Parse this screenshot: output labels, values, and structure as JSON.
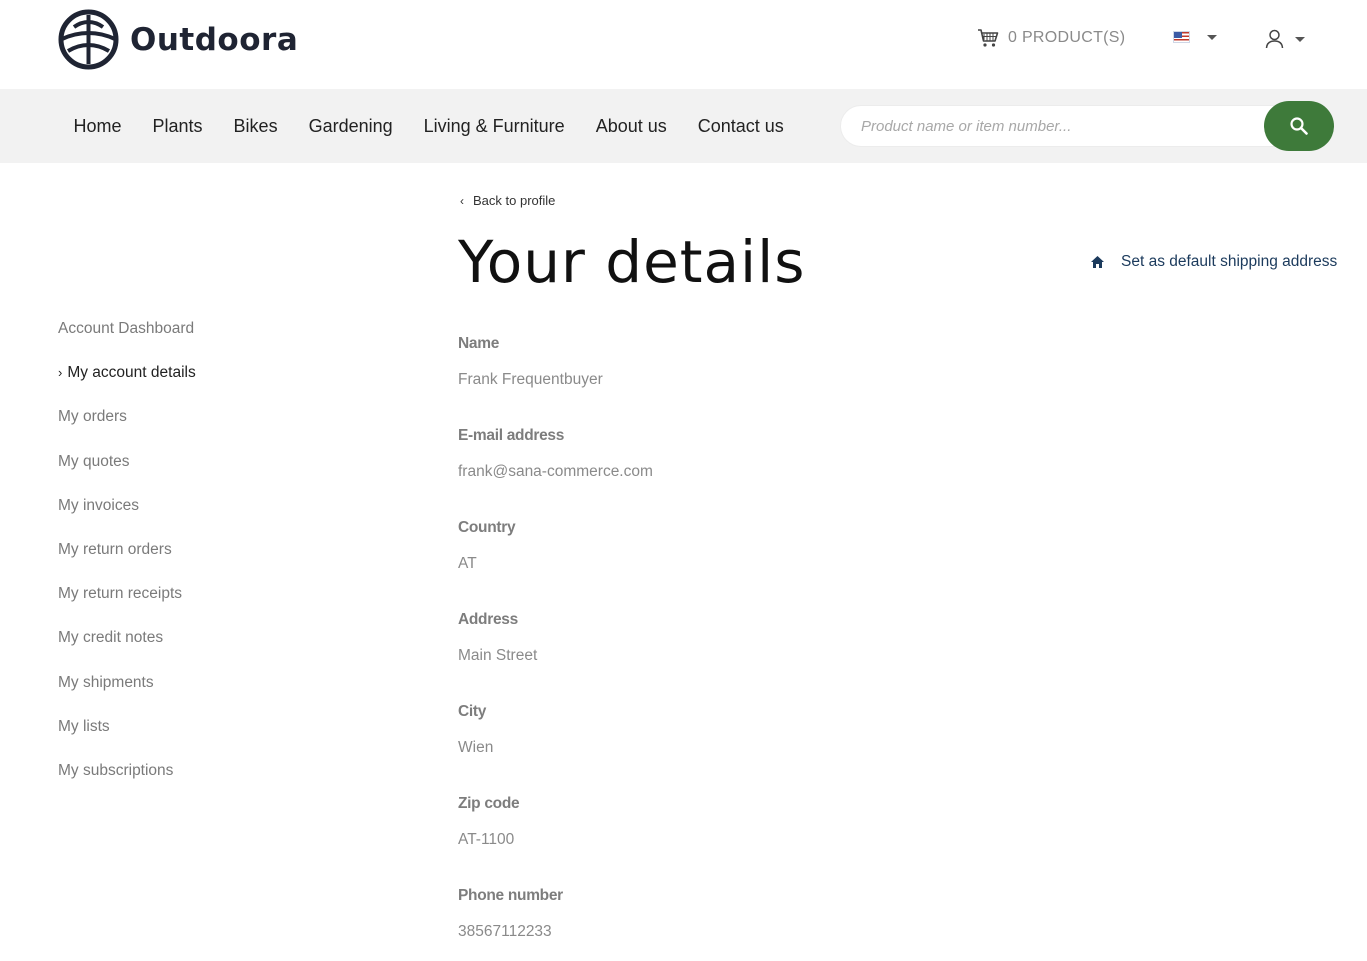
{
  "brand": {
    "name": "Outdoora"
  },
  "header": {
    "cart_label": "0 PRODUCT(S)"
  },
  "nav": {
    "items": [
      "Home",
      "Plants",
      "Bikes",
      "Gardening",
      "Living & Furniture",
      "About us",
      "Contact us"
    ]
  },
  "search": {
    "placeholder": "Product name or item number..."
  },
  "sidebar": {
    "items": [
      "Account Dashboard",
      "My account details",
      "My orders",
      "My quotes",
      "My invoices",
      "My return orders",
      "My return receipts",
      "My credit notes",
      "My shipments",
      "My lists",
      "My subscriptions"
    ]
  },
  "main": {
    "back_label": "Back to profile",
    "title": "Your details",
    "default_shipping_label": "Set as default shipping address",
    "fields": [
      {
        "label": "Name",
        "value": "Frank Frequentbuyer"
      },
      {
        "label": "E-mail address",
        "value": "frank@sana-commerce.com"
      },
      {
        "label": "Country",
        "value": "AT"
      },
      {
        "label": "Address",
        "value": "Main Street"
      },
      {
        "label": "City",
        "value": "Wien"
      },
      {
        "label": "Zip code",
        "value": "AT-1100"
      },
      {
        "label": "Phone number",
        "value": "38567112233"
      }
    ]
  },
  "colors": {
    "accent_green": "#3e7a3a",
    "navbar_bg": "#f2f2f2",
    "link_blue": "#1b3a5c",
    "logo_dark": "#1f2433"
  }
}
